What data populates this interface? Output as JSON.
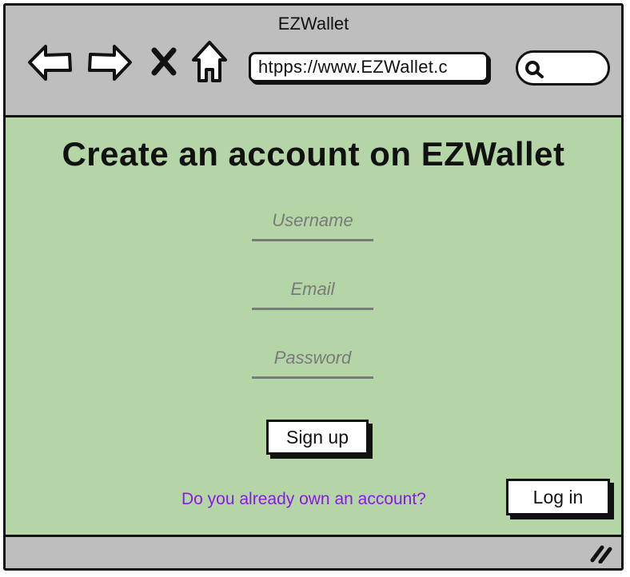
{
  "window": {
    "title": "EZWallet"
  },
  "toolbar": {
    "icons": [
      "back-arrow-icon",
      "forward-arrow-icon",
      "close-icon",
      "home-icon",
      "search-icon"
    ],
    "url": "htpps://www.EZWallet.c",
    "search_value": ""
  },
  "main": {
    "heading": "Create an account on EZWallet",
    "form": {
      "username_placeholder": "Username",
      "email_placeholder": "Email",
      "password_placeholder": "Password",
      "signup_label": "Sign up"
    },
    "login_prompt": "Do you already own an account?",
    "login_label": "Log in"
  },
  "colors": {
    "content_bg": "#b4d6a6",
    "chrome_bg": "#bebebe",
    "link": "#8b18e6",
    "placeholder": "#7a7a7a"
  }
}
